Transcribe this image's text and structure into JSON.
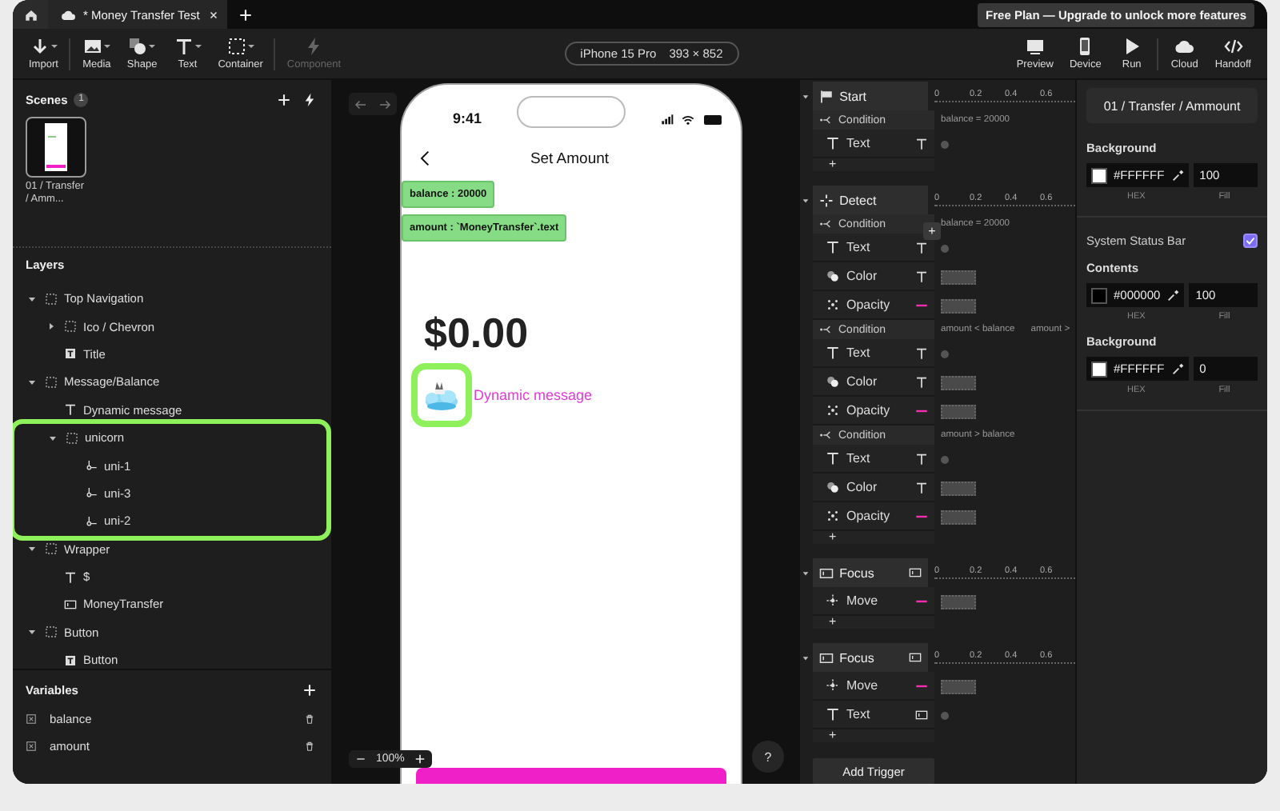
{
  "tabs": [
    {
      "title": "* Money Transfer Test",
      "selected": true
    }
  ],
  "plan_notice": "Free Plan — Upgrade to unlock more features",
  "toolbar": {
    "tool_groups": [
      {
        "tools": [
          {
            "kind": "import",
            "label": "Import",
            "disabled": false
          }
        ]
      },
      {
        "tools": [
          {
            "kind": "media",
            "label": "Media",
            "disabled": false
          },
          {
            "kind": "shape",
            "label": "Shape",
            "disabled": false
          },
          {
            "kind": "text",
            "label": "Text",
            "disabled": false
          },
          {
            "kind": "container",
            "label": "Container",
            "disabled": false
          }
        ]
      },
      {
        "tools": [
          {
            "kind": "component",
            "label": "Component",
            "disabled": true
          }
        ]
      }
    ],
    "device": "iPhone 15 Pro",
    "device_size": "393 × 852",
    "action_groups": [
      {
        "actions": [
          {
            "kind": "preview",
            "label": "Preview"
          },
          {
            "kind": "device",
            "label": "Device"
          },
          {
            "kind": "run",
            "label": "Run"
          }
        ]
      },
      {
        "actions": [
          {
            "kind": "cloud",
            "label": "Cloud"
          },
          {
            "kind": "handoff",
            "label": "Handoff"
          }
        ]
      }
    ]
  },
  "scenes": {
    "title": "Scenes",
    "count": "1",
    "items": [
      {
        "label": "01 / Transfer / Amm...",
        "selected": true
      }
    ]
  },
  "layers": {
    "title": "Layers",
    "items": [
      {
        "kind": "frame",
        "label": "Top Navigation",
        "expanded": true,
        "highlighted": false,
        "children": [
          {
            "kind": "frame",
            "label": "Ico / Chevron",
            "expanded": false,
            "highlighted": false
          },
          {
            "kind": "textbox",
            "label": "Title",
            "highlighted": false
          }
        ]
      },
      {
        "kind": "frame",
        "label": "Message/Balance",
        "expanded": true,
        "highlighted": false,
        "children": [
          {
            "kind": "text",
            "label": "Dynamic message",
            "highlighted": false
          },
          {
            "kind": "frame",
            "label": "unicorn",
            "expanded": true,
            "highlighted": true,
            "children": [
              {
                "kind": "path",
                "label": "uni-1",
                "highlighted": false
              },
              {
                "kind": "path",
                "label": "uni-3",
                "highlighted": false
              },
              {
                "kind": "path",
                "label": "uni-2",
                "highlighted": false
              }
            ]
          }
        ]
      },
      {
        "kind": "frame",
        "label": "Wrapper",
        "expanded": true,
        "highlighted": false,
        "children": [
          {
            "kind": "text",
            "label": "$",
            "highlighted": false
          },
          {
            "kind": "input",
            "label": "MoneyTransfer",
            "highlighted": false
          }
        ]
      },
      {
        "kind": "frame",
        "label": "Button",
        "expanded": true,
        "highlighted": false,
        "children": [
          {
            "kind": "textbox",
            "label": "Button",
            "highlighted": false
          }
        ]
      }
    ]
  },
  "variables": {
    "title": "Variables",
    "items": [
      {
        "name": "balance"
      },
      {
        "name": "amount"
      }
    ]
  },
  "phone": {
    "time": "9:41",
    "title": "Set Amount",
    "tags": [
      "balance : 20000",
      "amount : `MoneyTransfer`.text"
    ],
    "amount": "$0.00",
    "image": {
      "highlighted": true
    },
    "message": "Dynamic message",
    "zoom": "100%",
    "help": "?"
  },
  "triggers": [
    {
      "kind": "start",
      "label": "Start",
      "expanded": true,
      "ticks": [
        "0",
        "0.2",
        "0.4",
        "0.6"
      ],
      "conditions": [
        {
          "label": "Condition",
          "expressions": [
            "balance = 20000"
          ],
          "actions": [
            {
              "kind": "text",
              "label": "Text",
              "target": {
                "kind": "text"
              }
            }
          ]
        }
      ],
      "add": "+"
    },
    {
      "kind": "detect",
      "label": "Detect",
      "expanded": true,
      "ticks": [
        "0",
        "0.2",
        "0.4",
        "0.6"
      ],
      "conditions": [
        {
          "label": "Condition",
          "expressions": [
            "balance = 20000"
          ],
          "hover_add": "+",
          "actions": [
            {
              "kind": "text",
              "label": "Text",
              "target": {
                "kind": "text"
              }
            },
            {
              "kind": "color",
              "label": "Color",
              "target": {
                "kind": "text"
              }
            },
            {
              "kind": "opacity",
              "label": "Opacity",
              "target": {
                "kind": "dash"
              }
            }
          ]
        },
        {
          "label": "Condition",
          "expressions": [
            "amount < balance",
            "amount >"
          ],
          "actions": [
            {
              "kind": "text",
              "label": "Text",
              "target": {
                "kind": "text"
              }
            },
            {
              "kind": "color",
              "label": "Color",
              "target": {
                "kind": "text"
              }
            },
            {
              "kind": "opacity",
              "label": "Opacity",
              "target": {
                "kind": "dash"
              }
            }
          ]
        },
        {
          "label": "Condition",
          "expressions": [
            "amount > balance"
          ],
          "actions": [
            {
              "kind": "text",
              "label": "Text",
              "target": {
                "kind": "text"
              }
            },
            {
              "kind": "color",
              "label": "Color",
              "target": {
                "kind": "text"
              }
            },
            {
              "kind": "opacity",
              "label": "Opacity",
              "target": {
                "kind": "dash"
              }
            }
          ]
        }
      ],
      "add": "+"
    },
    {
      "kind": "focus",
      "label": "Focus",
      "expanded": true,
      "target": {
        "kind": "input"
      },
      "ticks": [
        "0",
        "0.2",
        "0.4",
        "0.6"
      ],
      "actions": [
        {
          "kind": "move",
          "label": "Move",
          "target": {
            "kind": "dash"
          }
        }
      ],
      "add": "+"
    },
    {
      "kind": "focus",
      "label": "Focus",
      "expanded": true,
      "target": {
        "kind": "input"
      },
      "ticks": [
        "0",
        "0.2",
        "0.4",
        "0.6"
      ],
      "actions": [
        {
          "kind": "move",
          "label": "Move",
          "target": {
            "kind": "dash"
          }
        },
        {
          "kind": "text",
          "label": "Text",
          "target": {
            "kind": "input"
          }
        }
      ],
      "add": "+"
    }
  ],
  "add_trigger": "Add Trigger",
  "properties": {
    "title": "01 / Transfer / Ammount",
    "sections": [
      {
        "kind": "color",
        "label": "Background",
        "hex": "#FFFFFF",
        "color": "#ffffff",
        "fill": "100",
        "hex_label": "HEX",
        "fill_label": "Fill"
      },
      {
        "kind": "toggle",
        "label": "System Status Bar",
        "checked": true
      },
      {
        "kind": "color",
        "label": "Contents",
        "hex": "#000000",
        "color": "#000000",
        "fill": "100",
        "hex_label": "HEX",
        "fill_label": "Fill"
      },
      {
        "kind": "color",
        "label": "Background",
        "hex": "#FFFFFF",
        "color": "#ffffff",
        "fill": "0",
        "hex_label": "HEX",
        "fill_label": "Fill"
      }
    ]
  }
}
